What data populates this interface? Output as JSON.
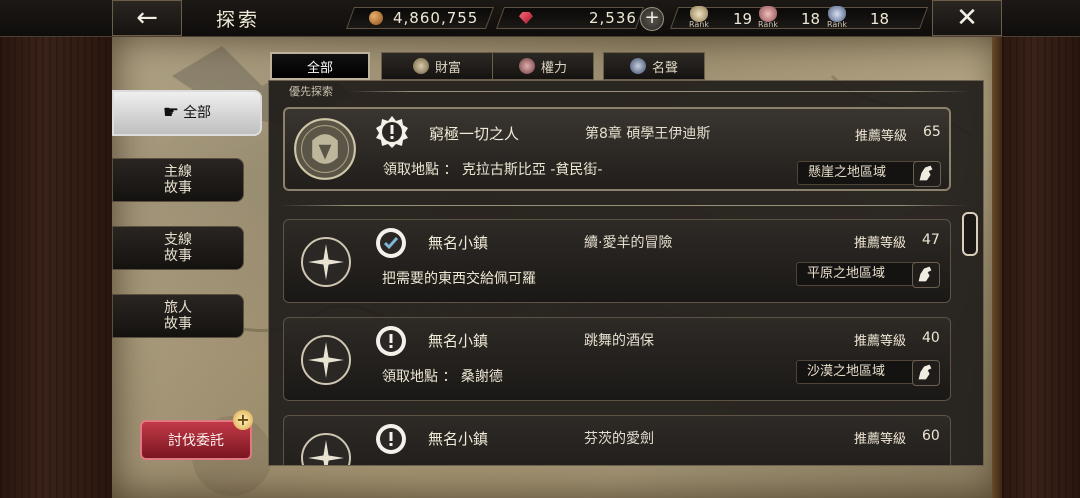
{
  "header": {
    "title": "探索",
    "back_icon": "←",
    "close_icon": "✕",
    "gold": "4,860,755",
    "gems": "2,536",
    "plus": "+",
    "ranks": [
      {
        "label": "Rank",
        "value": "19",
        "color": "#d9c9a1"
      },
      {
        "label": "Rank",
        "value": "18",
        "color": "#d8a0a0"
      },
      {
        "label": "Rank",
        "value": "18",
        "color": "#b8c0d8"
      }
    ]
  },
  "tabs": [
    {
      "label": "全部",
      "icon": "",
      "active": true
    },
    {
      "label": "財富",
      "icon": "wealth-icon"
    },
    {
      "label": "權力",
      "icon": "power-icon"
    },
    {
      "label": "名聲",
      "icon": "fame-icon"
    }
  ],
  "left_menu": [
    {
      "label": "全部",
      "active": true
    },
    {
      "label": "主線\n故事"
    },
    {
      "label": "支線\n故事"
    },
    {
      "label": "旅人\n故事"
    }
  ],
  "request_button": "討伐委託",
  "priority_label": "優先探索",
  "priority_quest": {
    "name": "窮極一切之人",
    "quest": "第8章  碩學王伊迪斯",
    "rec_label": "推薦等級",
    "rec_level": "65",
    "detail": "領取地點  ：  克拉古斯比亞  -貧民街-",
    "region": "懸崖之地區域"
  },
  "quests": [
    {
      "name": "無名小鎮",
      "quest": "續·愛羊的冒險",
      "rec_label": "推薦等級",
      "rec_level": "47",
      "detail": "把需要的東西交給佩可羅",
      "region": "平原之地區域",
      "status": "check"
    },
    {
      "name": "無名小鎮",
      "quest": "跳舞的酒保",
      "rec_label": "推薦等級",
      "rec_level": "40",
      "detail": "領取地點  ：  桑謝德",
      "region": "沙漠之地區域",
      "status": "exclaim"
    },
    {
      "name": "無名小鎮",
      "quest": "芬茨的愛劍",
      "rec_label": "推薦等級",
      "rec_level": "60",
      "detail": "",
      "region": "",
      "status": "exclaim"
    }
  ]
}
